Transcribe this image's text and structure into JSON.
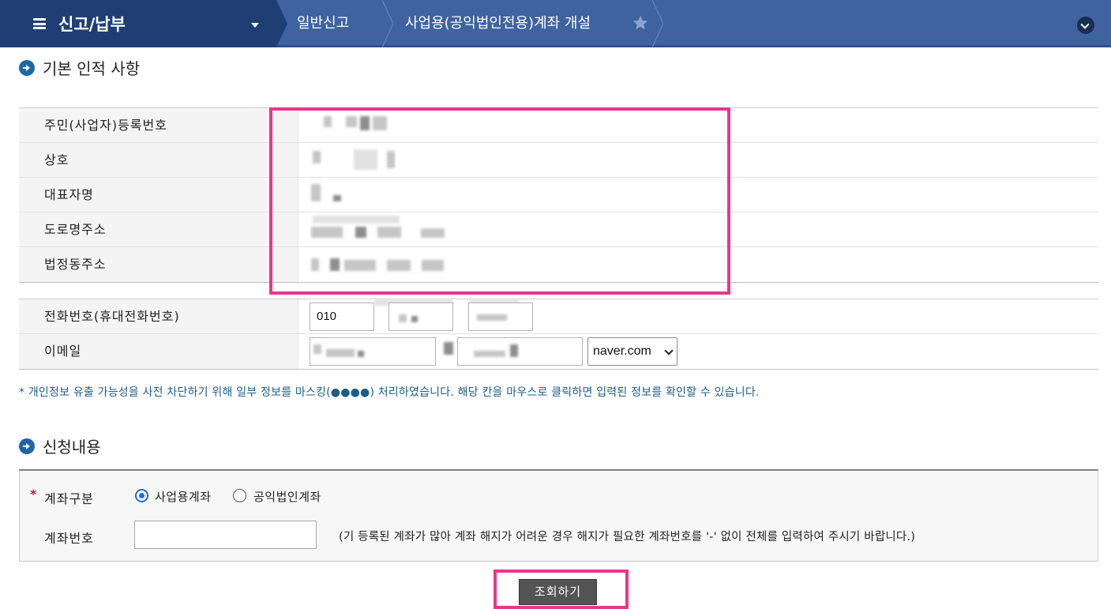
{
  "nav": {
    "menu_title": "신고/납부",
    "breadcrumbs": [
      "일반신고",
      "사업용(공익법인전용)계좌 개설"
    ]
  },
  "basic_info": {
    "title": "기본 인적 사항",
    "rows": [
      {
        "label": "주민(사업자)등록번호"
      },
      {
        "label": "상호"
      },
      {
        "label": "대표자명"
      },
      {
        "label": "도로명주소"
      },
      {
        "label": "법정동주소"
      }
    ]
  },
  "contact": {
    "phone_label": "전화번호(휴대전화번호)",
    "phone_first": "010",
    "email_label": "이메일",
    "email_domain": "naver.com"
  },
  "note": "* 개인정보 유출 가능성을 사전 차단하기 위해 일부 정보를 마스킹(●●●●) 처리하였습니다. 해당 칸을 마우스로 클릭하면 입력된 정보를 확인할 수 있습니다.",
  "application": {
    "title": "신청내용",
    "account_type_label": "계좌구분",
    "required_mark": "*",
    "options": [
      "사업용계좌",
      "공익법인계좌"
    ],
    "selected_option": "사업용계좌",
    "account_number_label": "계좌번호",
    "account_number_value": "",
    "guide_text": "(기 등록된 계좌가 많아 계좌 해지가 어려운 경우 해지가 필요한 계좌번호를 '-' 없이 전체를 입력하여 주시기 바랍니다.)"
  },
  "search_button": "조회하기",
  "colors": {
    "nav_bar": "#3e63a0",
    "nav_menu": "#1f3f74",
    "highlight": "#e6378c",
    "note_text": "#1b5e8a"
  }
}
